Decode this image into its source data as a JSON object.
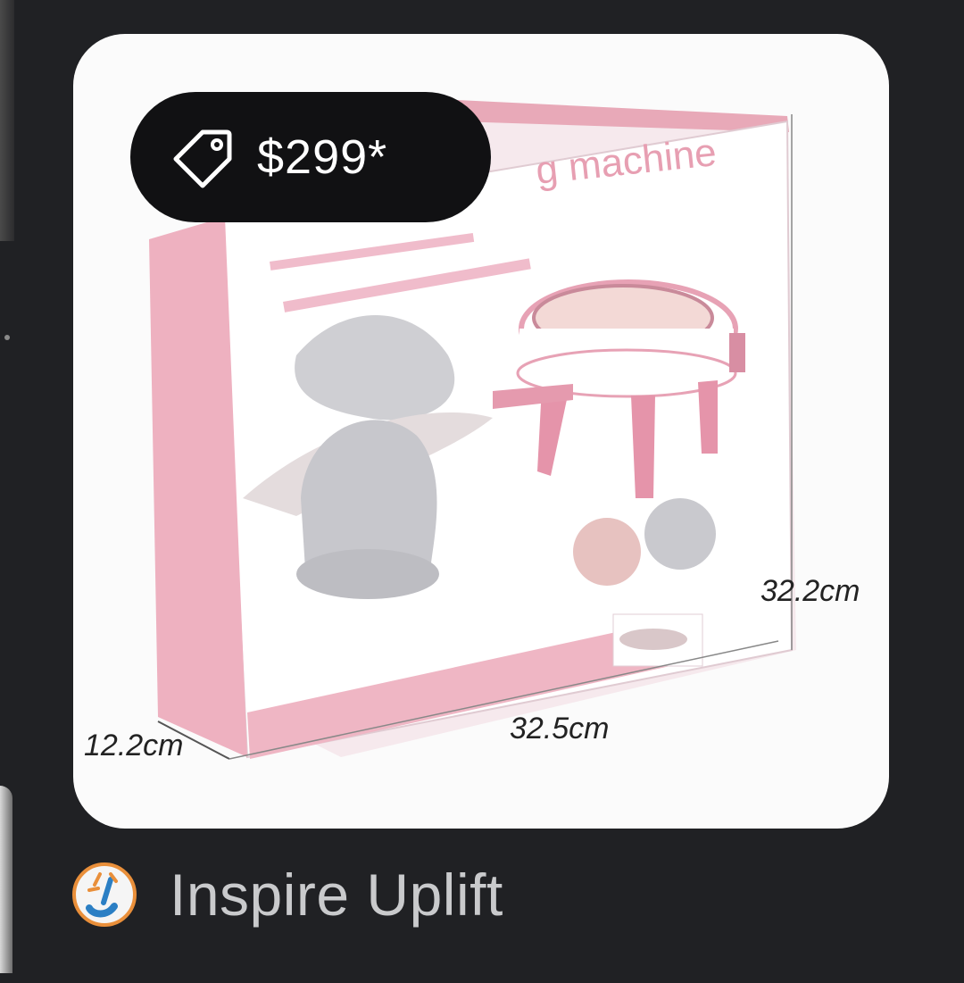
{
  "product": {
    "price": "$299*",
    "dimensions": {
      "height": "32.2cm",
      "width": "32.5cm",
      "depth": "12.2cm"
    },
    "image_icon": "knitting-machine-box-image"
  },
  "seller": {
    "name": "Inspire Uplift",
    "logo_icon": "inspire-uplift-logo"
  },
  "colors": {
    "background": "#202124",
    "card": "#fbfbfb",
    "price_pill": "#111113",
    "brand_text": "#c9cacc",
    "accent_pink": "#e8a9b8"
  }
}
